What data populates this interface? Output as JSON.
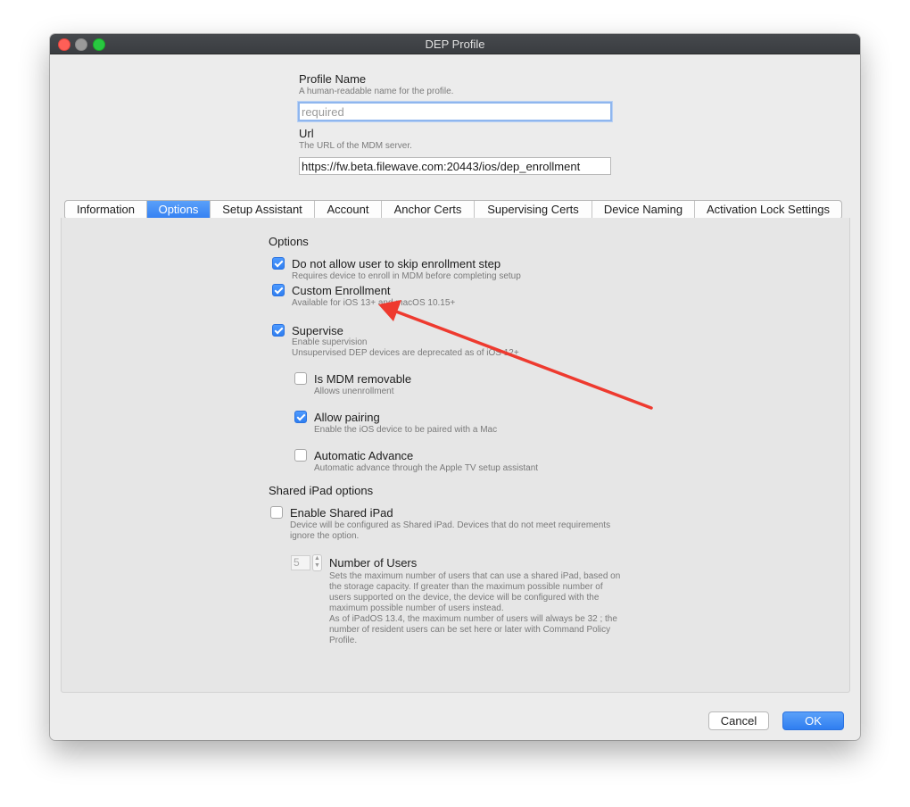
{
  "window": {
    "title": "DEP Profile"
  },
  "profile_name": {
    "label": "Profile Name",
    "help": "A human-readable name for the profile.",
    "value": "",
    "placeholder": "required"
  },
  "url": {
    "label": "Url",
    "help": "The URL of the MDM server.",
    "value": "https://fw.beta.filewave.com:20443/ios/dep_enrollment"
  },
  "tabs": [
    {
      "label": "Information",
      "active": false
    },
    {
      "label": "Options",
      "active": true
    },
    {
      "label": "Setup Assistant",
      "active": false
    },
    {
      "label": "Account",
      "active": false
    },
    {
      "label": "Anchor Certs",
      "active": false
    },
    {
      "label": "Supervising Certs",
      "active": false
    },
    {
      "label": "Device Naming",
      "active": false
    },
    {
      "label": "Activation Lock Settings",
      "active": false
    }
  ],
  "options": {
    "title": "Options",
    "skip_enrollment": {
      "label": "Do not allow user to skip enrollment step",
      "desc": "Requires device to enroll in MDM before completing setup",
      "checked": true
    },
    "custom_enrollment": {
      "label": "Custom Enrollment",
      "desc": "Available for iOS 13+ and macOS 10.15+",
      "checked": true
    },
    "supervise": {
      "label": "Supervise",
      "desc1": "Enable supervision",
      "desc2": "Unsupervised DEP devices are deprecated as of iOS 12+",
      "checked": true
    },
    "mdm_removable": {
      "label": "Is MDM removable",
      "desc": "Allows unenrollment",
      "checked": false
    },
    "allow_pairing": {
      "label": "Allow pairing",
      "desc": "Enable the iOS device to be paired with a Mac",
      "checked": true
    },
    "auto_advance": {
      "label": "Automatic Advance",
      "desc": "Automatic advance through the Apple TV setup assistant",
      "checked": false
    }
  },
  "shared_ipad": {
    "title": "Shared iPad options",
    "enable": {
      "label": "Enable Shared iPad",
      "desc1": "Device will be configured as Shared iPad. Devices that do not meet requirements",
      "desc2": "ignore the option.",
      "checked": false
    },
    "num_users": {
      "label": "Number of Users",
      "value": "5",
      "desc": [
        "Sets the maximum number of users that can use a shared iPad, based on",
        "the storage capacity. If greater than the maximum possible number of",
        "users supported on the device, the device will be configured with the",
        "maximum possible number of users instead.",
        "As of iPadOS 13.4, the maximum number of users will always be 32 ; the",
        "number of resident users can be set here or later with Command Policy",
        "Profile."
      ]
    }
  },
  "buttons": {
    "cancel": "Cancel",
    "ok": "OK"
  },
  "annotation": {
    "arrow_color": "#ee3a2f",
    "icon": "red-arrow-icon"
  }
}
